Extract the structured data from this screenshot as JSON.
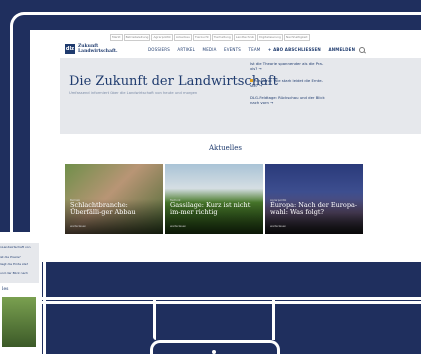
{
  "topbar": {
    "links": [
      "Markt",
      "Betriebsleitung",
      "Agrarpolitik",
      "Ackerbau",
      "Tierzucht",
      "Tierhaltung",
      "Landtechnik",
      "Digitalisierung",
      "Nachhaltigkeit"
    ]
  },
  "logo": {
    "box_text": "dlz",
    "name_line1": "Zukunft",
    "name_line2": "Landwirtschaft."
  },
  "nav": {
    "items": [
      "DOSSIERS",
      "ARTIKEL",
      "MEDIA",
      "EVENTS",
      "TEAM"
    ],
    "subscribe": "+ ABO ABSCHLIESSEN",
    "login": "ANMELDEN"
  },
  "hero": {
    "title": "Die Zukunft der Landwirtschaft",
    "subtitle": "Umfassend informiert über die Landwirtschaft von heute und morgen",
    "news": [
      "Ist die Theorie spannender als die Pra-xis?",
      "Russland: Wie stark leidet die Ernte-ste?",
      "DLG-Feldtage: Rückschau und der Blick nach vorn"
    ]
  },
  "section": {
    "title": "Aktuelles"
  },
  "cards": [
    {
      "tag": "Betrieb",
      "title": "Schlachtbranche: Überfälli-ger Abbau",
      "more": "weiterlesen"
    },
    {
      "tag": "Technik",
      "title": "Gassilage: Kurz ist nicht im-mer richtig",
      "more": "weiterlesen"
    },
    {
      "tag": "Agrarpolitik",
      "title": "Europa: Nach der Europa-wahl: Was folgt?",
      "more": "weiterlesen"
    }
  ],
  "laptop": {
    "news": [
      "nLandwirtschaft von",
      "ist die Praxis?",
      "liegt die Ernte ste?",
      "und der Blick nach"
    ],
    "heading": "les"
  },
  "colors": {
    "background": "#1f2f5e",
    "brand": "#1f3b6e",
    "accent": "#e0a020",
    "hero_bg": "#e6e8ec"
  }
}
